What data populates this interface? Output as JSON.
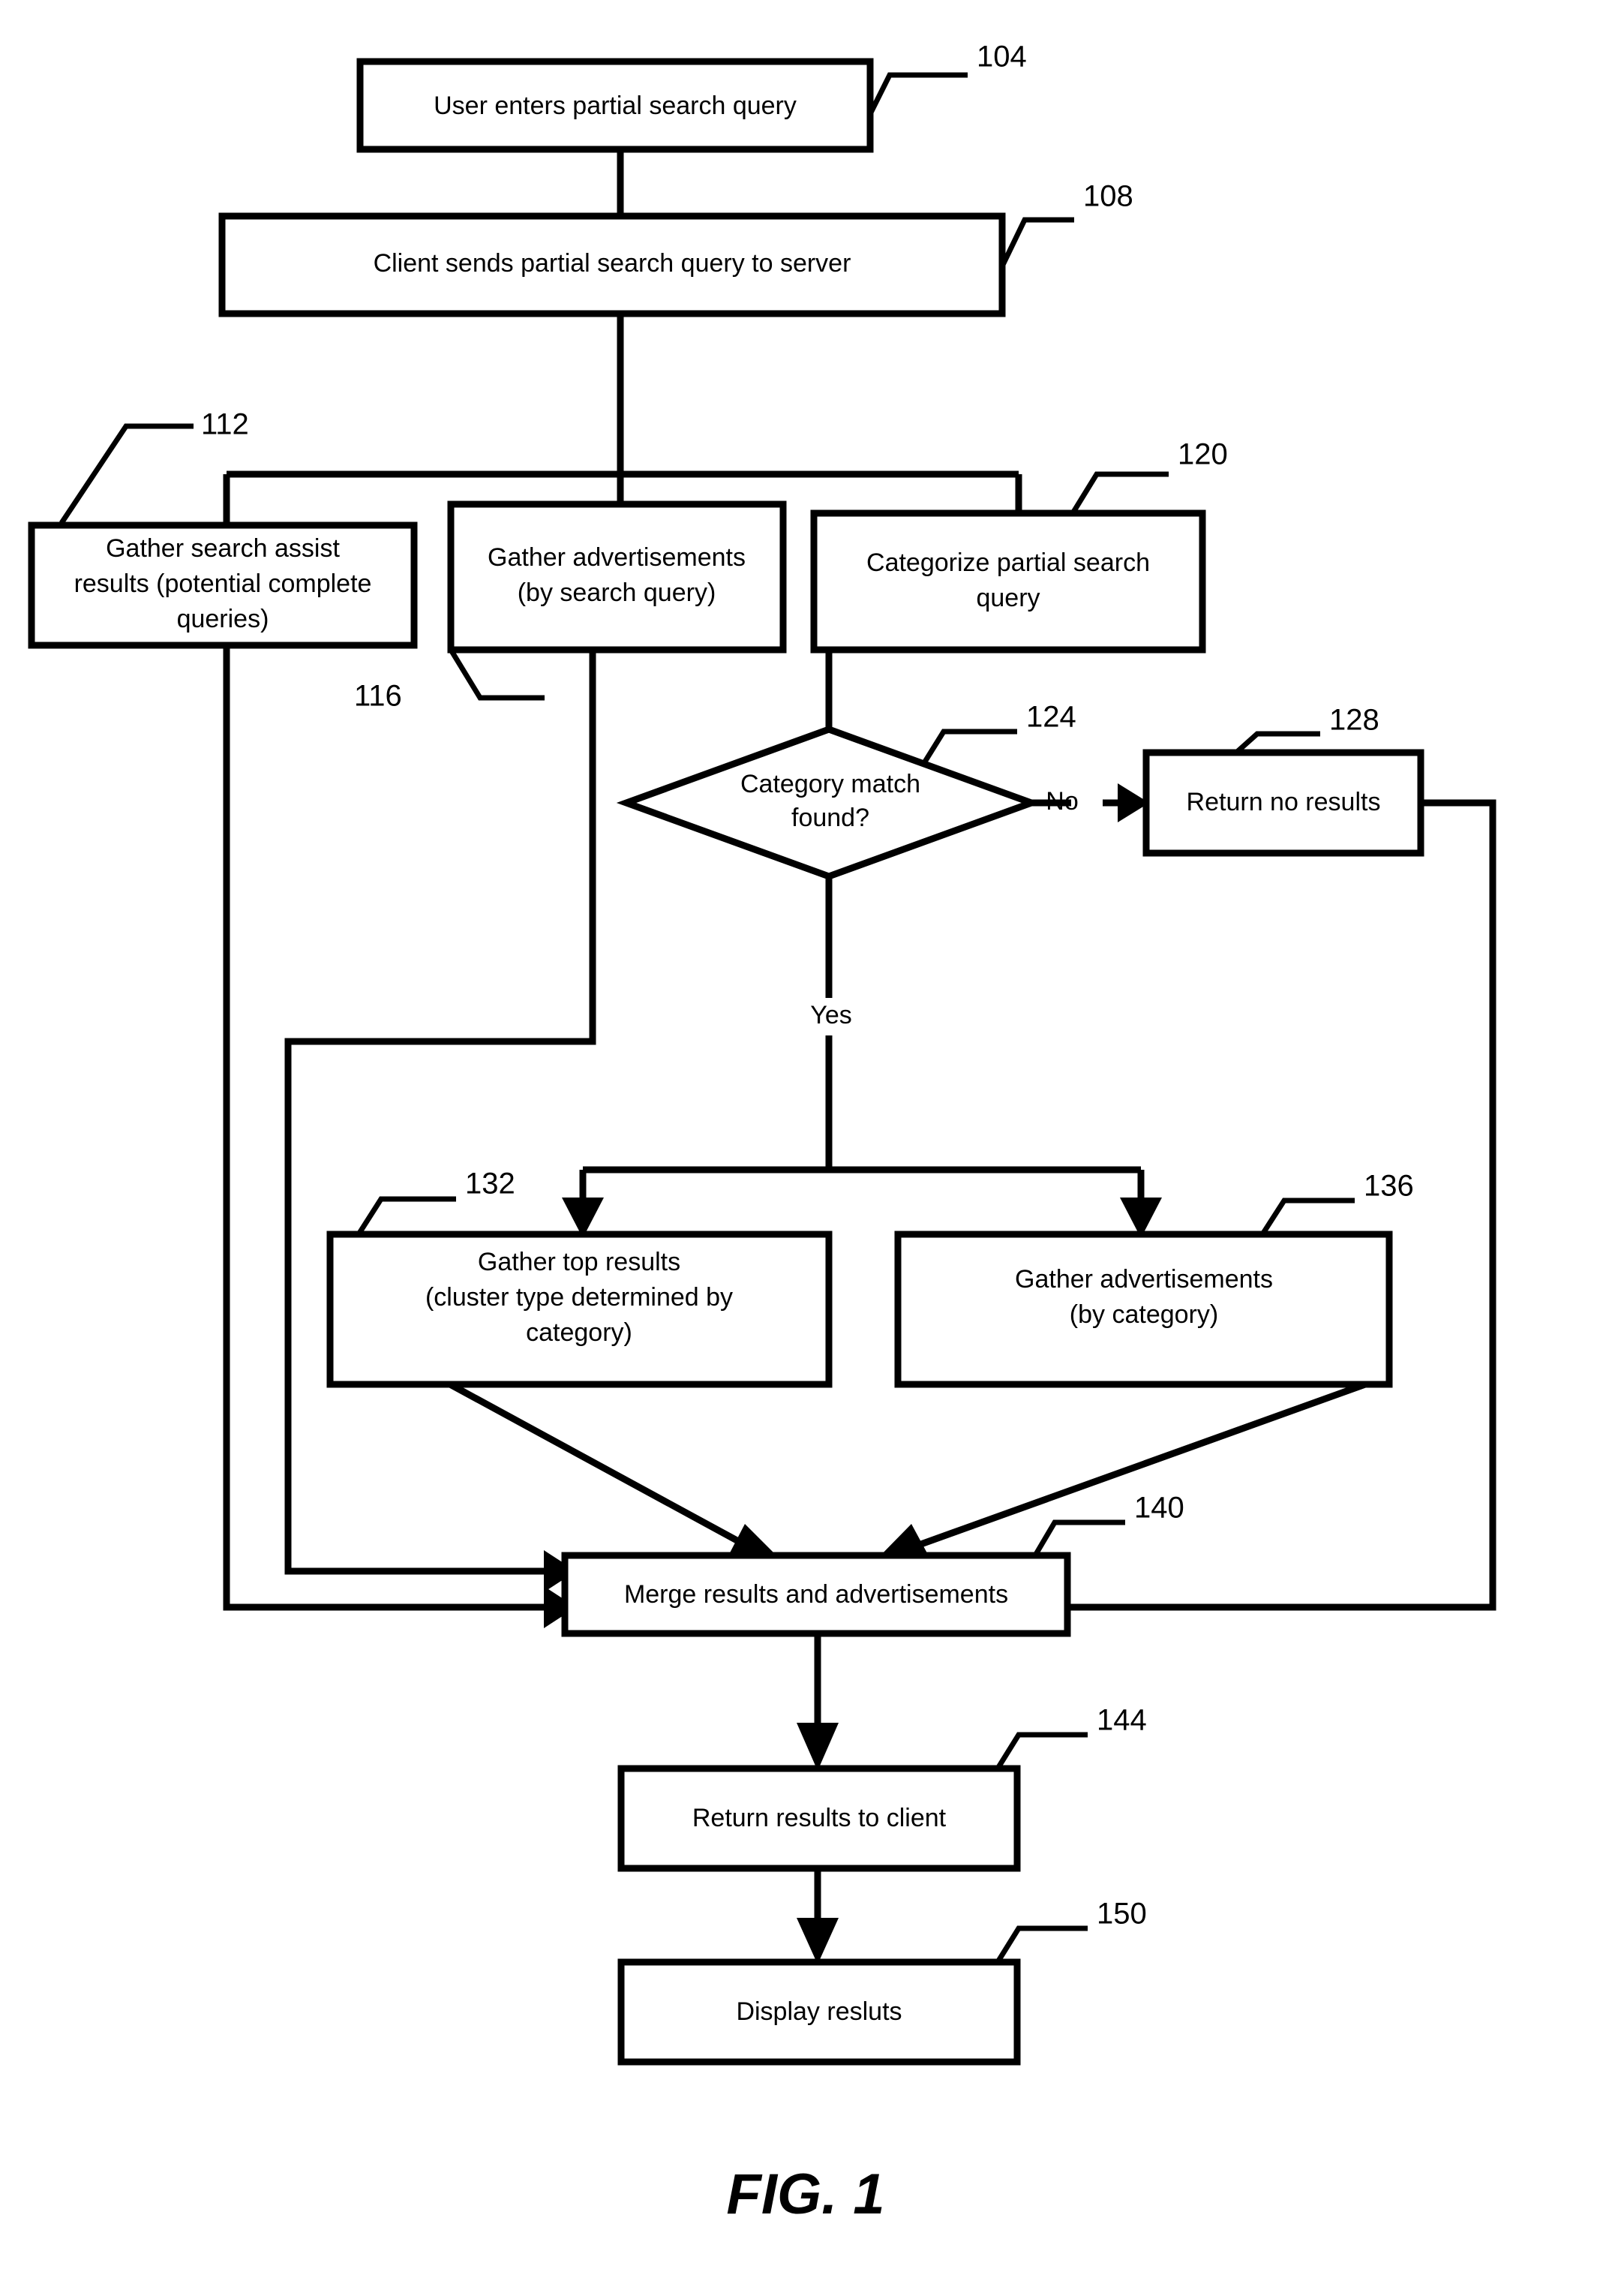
{
  "figure": {
    "caption": "FIG. 1",
    "type": "flowchart"
  },
  "nodes": {
    "n104": {
      "ref": "104",
      "line1": "User enters partial search query"
    },
    "n108": {
      "ref": "108",
      "line1": "Client sends partial search query to server"
    },
    "n112": {
      "ref": "112",
      "line1": "Gather search assist",
      "line2": "results (potential complete",
      "line3": "queries)"
    },
    "n116": {
      "ref": "116",
      "line1": "Gather advertisements",
      "line2": "(by search query)"
    },
    "n120": {
      "ref": "120",
      "line1": "Categorize partial search",
      "line2": "query"
    },
    "n124": {
      "ref": "124",
      "line1": "Category match",
      "line2": "found?"
    },
    "n128": {
      "ref": "128",
      "line1": "Return no results"
    },
    "n132": {
      "ref": "132",
      "line1": "Gather top results",
      "line2": "(cluster type determined by",
      "line3": "category)"
    },
    "n136": {
      "ref": "136",
      "line1": "Gather advertisements",
      "line2": "(by category)"
    },
    "n140": {
      "ref": "140",
      "line1": "Merge results and advertisements"
    },
    "n144": {
      "ref": "144",
      "line1": "Return results to client"
    },
    "n150": {
      "ref": "150",
      "line1": "Display resluts"
    }
  },
  "edge_labels": {
    "no": "No",
    "yes": "Yes"
  },
  "colors": {
    "stroke": "#000000",
    "fill": "#ffffff"
  }
}
